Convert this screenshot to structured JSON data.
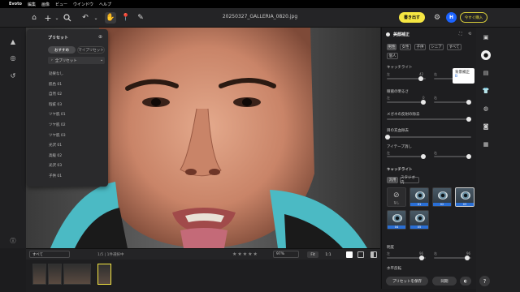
{
  "menubar": {
    "app": "Evoto",
    "items": [
      "編集",
      "画像",
      "ビュー",
      "ウインドウ",
      "ヘルプ"
    ]
  },
  "toolbar": {
    "doc_title": "20250327_GALLERIA_0820.jpg",
    "export_label": "書き出す",
    "avatar_letter": "H",
    "upgrade_label": "今すぐ購入"
  },
  "presets": {
    "title": "プリセット",
    "tabs": [
      "おすすめ",
      "マイプリセット"
    ],
    "group": "全プリセット",
    "items": [
      "効果なし",
      "肌色 01",
      "自然 02",
      "瑕疵 03",
      "ツヤ肌 01",
      "ツヤ肌 02",
      "ツヤ肌 03",
      "光沢 01",
      "高級 02",
      "光沢 03",
      "子供 01"
    ]
  },
  "adjust": {
    "title": "美顔補正",
    "scope_tabs": [
      "男性",
      "女性",
      "子供",
      "シニア",
      "すべて"
    ],
    "scope_all": "個人",
    "sections": [
      {
        "label": "キャッチライト",
        "sub_left": "左",
        "sub_right": "右",
        "left_value": "42",
        "right_value": "38"
      },
      {
        "label": "眼窩の明るさ",
        "sub_left": "左",
        "sub_right": "右",
        "left_value": "0",
        "right_value": "0"
      },
      {
        "label": "メガネの反射の除去"
      },
      {
        "label": "目の充血除去"
      },
      {
        "label": "アイテープ消し",
        "sub_left": "左",
        "sub_right": "右"
      }
    ],
    "catchlight_title": "キャッチライト",
    "catchlight_tabs": [
      "汎用",
      "スタジオ内"
    ],
    "catchlight_none": "なし",
    "thumb_caps": [
      "01",
      "02",
      "03",
      "04",
      "05",
      "06"
    ],
    "brightness_label": "明度",
    "brightness_left": "左",
    "brightness_right": "右",
    "brightness_left_value": "96",
    "brightness_right_value": "96",
    "flip_label": "水平反転",
    "save_preset": "プリセットを保存",
    "sync": "同期"
  },
  "tooltip": {
    "title": "背景補正",
    "sub": "B"
  },
  "bottombar": {
    "filter": "すべて",
    "count": "1/5 | 1件選択中",
    "zoom": "97%",
    "fit": "Fit",
    "ratio": "1:1"
  },
  "filmstrip_count": 4,
  "colors": {
    "accent": "#f5e642",
    "avatar": "#1b63ff",
    "selected": "#2a6fd6"
  },
  "icons": [
    "home-icon",
    "plus-icon",
    "search-icon",
    "undo-icon",
    "redo-icon",
    "hand-icon",
    "pin-icon",
    "brush-icon",
    "eraser-icon",
    "help-icon"
  ]
}
